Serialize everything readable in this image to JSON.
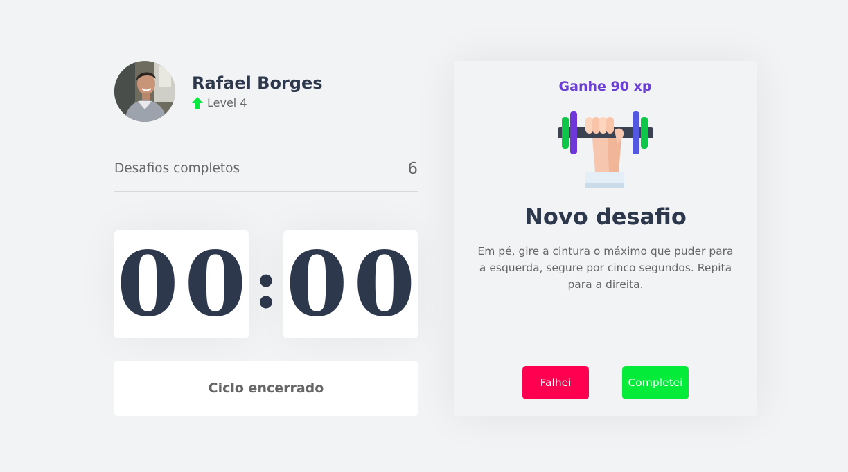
{
  "profile": {
    "name": "Rafael Borges",
    "level_label": "Level 4",
    "level_icon": "level-up-arrow-icon",
    "level_icon_color": "#08E83E"
  },
  "stats": {
    "completed_label": "Desafios completos",
    "completed_value": "6"
  },
  "countdown": {
    "minute_tens": "0",
    "minute_units": "0",
    "separator": ":",
    "second_tens": "0",
    "second_units": "0"
  },
  "cycle_button": {
    "label": "Ciclo encerrado"
  },
  "challenge": {
    "reward": "Ganhe 90 xp",
    "illustration_icon": "dumbbell-icon",
    "title": "Novo desafio",
    "description": "Em pé, gire a cintura o máximo que puder para a esquerda, segure por cinco segundos. Repita para a direita.",
    "fail_label": "Falhei",
    "done_label": "Completei"
  },
  "colors": {
    "background": "#F2F3F5",
    "title": "#2E384D",
    "text": "#666666",
    "accent_purple": "#6C3FD4",
    "fail_red": "#FF0050",
    "success_green": "#04EB3A"
  }
}
